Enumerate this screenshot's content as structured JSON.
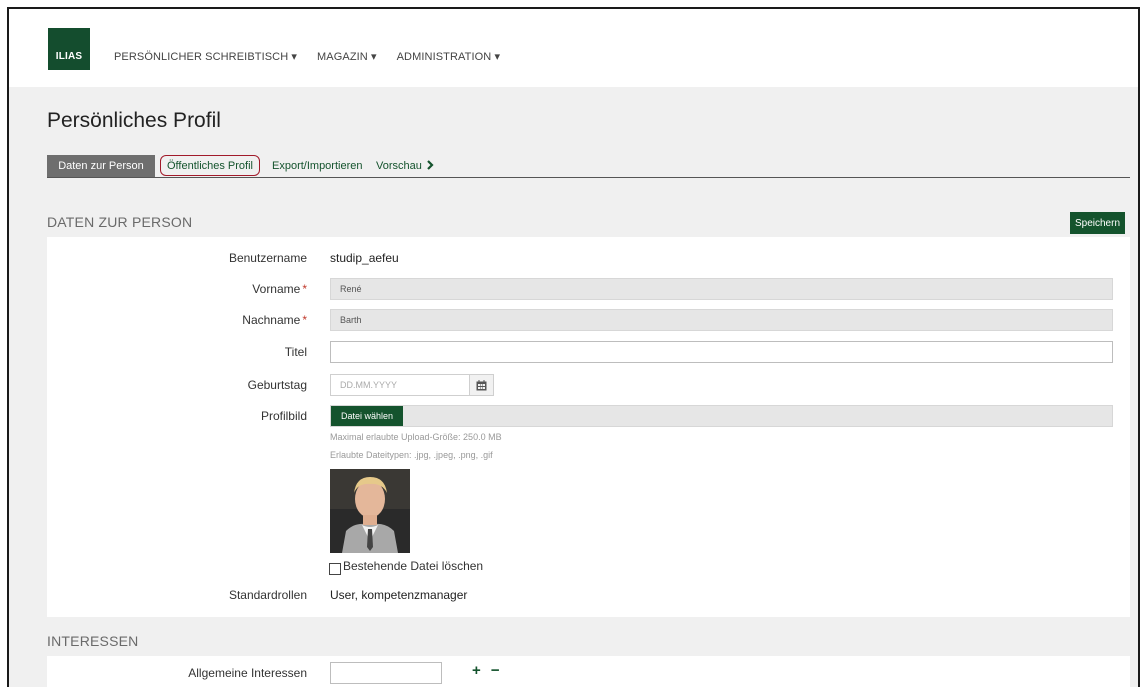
{
  "app": {
    "logo_text": "ILIAS",
    "brand_color": "#144d2e"
  },
  "mainnav": {
    "items": [
      "PERSÖNLICHER SCHREIBTISCH ▾",
      "MAGAZIN ▾",
      "ADMINISTRATION ▾"
    ]
  },
  "page": {
    "title": "Persönliches Profil"
  },
  "tabs": {
    "items": [
      "Daten zur Person",
      "Öffentliches Profil",
      "Export/Importieren",
      "Vorschau"
    ],
    "active": "Daten zur Person"
  },
  "section1": {
    "title": "DATEN ZUR PERSON",
    "save_label": "Speichern"
  },
  "form": {
    "benutzername_label": "Benutzername",
    "benutzername_value": "studip_aefeu",
    "vorname_label": "Vorname",
    "vorname_value": "René",
    "nachname_label": "Nachname",
    "nachname_value": "Barth",
    "titel_label": "Titel",
    "titel_value": "",
    "geburtstag_label": "Geburtstag",
    "geburtstag_placeholder": "DD.MM.YYYY",
    "profilbild_label": "Profilbild",
    "file_button_label": "Datei wählen",
    "max_upload_hint": "Maximal erlaubte Upload-Größe: 250.0 MB",
    "file_types_hint": "Erlaubte Dateitypen: .jpg, .jpeg, .png, .gif",
    "delete_file_label": "Bestehende Datei löschen",
    "standardrollen_label": "Standardrollen",
    "standardrollen_value": "User, kompetenzmanager",
    "required_marker": "*"
  },
  "section2": {
    "title": "INTERESSEN",
    "allgemeine_label": "Allgemeine Interessen",
    "add_remove": "+ −"
  },
  "icons": {
    "calendar": "calendar-icon",
    "chevron": "chevron-right-icon",
    "avatar": "profile-photo"
  }
}
